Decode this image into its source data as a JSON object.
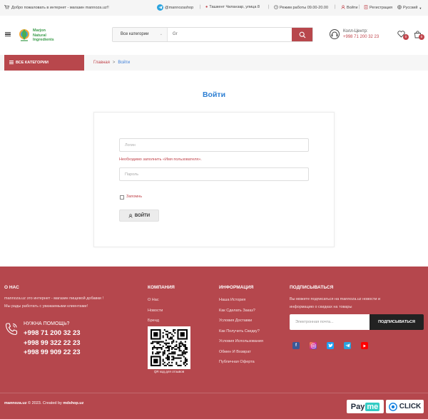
{
  "topbar": {
    "welcome": "Добро пожаловать в интернет - магазин mannoza.uz!!",
    "telegram": "@mannozashop",
    "address": "Ташкент Чиланзар, улица 8",
    "hours": "Режим работы 09.00-20.00",
    "login": "Войти",
    "register": "Регистрация",
    "language": "Русский"
  },
  "header": {
    "logo_lines": [
      "Marjon",
      "Natural",
      "Ingredients"
    ],
    "search_category": "Все категории",
    "search_value": "Gr",
    "callcenter_label": "Колл-Центр:",
    "callcenter_phone": "+998 71 200 32 23",
    "wishlist_count": "0",
    "cart_count": "0"
  },
  "nav": {
    "all_categories": "ВСЕ КАТЕГОРИИ",
    "breadcrumb_home": "Главная",
    "breadcrumb_sep": ">",
    "breadcrumb_current": "Войти"
  },
  "login": {
    "title": "Войти",
    "username_placeholder": "Логин",
    "username_error": "Необходимо заполнить «Имя пользователя».",
    "password_placeholder": "Пароль",
    "remember": "Запомнь",
    "submit": "ВОЙТИ"
  },
  "footer": {
    "about_title": "О НАС",
    "about_text_1": "mannoza.uz это интернет - магазин пищевой добавки !",
    "about_text_2": "Мы рады работать с уважаемыми клиентами!",
    "help_title": "НУЖНА ПОМОЩЬ?",
    "phones": [
      "+998 71 200 32 23",
      "+998 99 322 22 23",
      "+998 99 909 22 23"
    ],
    "company_title": "КОМПАНИЯ",
    "company_links": [
      "О Нас",
      "Новости",
      "Бренд"
    ],
    "qr_caption": "QR код для отзывов",
    "info_title": "ИНФОРМАЦИЯ",
    "info_links": [
      "Наша История",
      "Как Сделать Заказ?",
      "Условия Доставки",
      "Как Получить Скидку?",
      "Условия Использования",
      "Обмен И Возврат",
      "Публичная Оферта"
    ],
    "subscribe_title": "ПОДПИСЫВАТЬСЯ",
    "subscribe_text_1": "Вы можете подписаться на mannoza.uz новости и",
    "subscribe_text_2": "информацию о скидках на товары",
    "email_placeholder": "Электронная почта...",
    "subscribe_button": "ПОДПИСЫВАТЬСЯ",
    "copyright_site": "mannoza.uz",
    "copyright_text": " © 2023. Created by ",
    "copyright_author": "mdshop.uz",
    "payme_pay": "Pay",
    "payme_me": "me",
    "click_label": "CLICK"
  },
  "colors": {
    "brand": "#b5474d",
    "title_blue": "#2d7fd3",
    "error_red": "#c0434a"
  }
}
